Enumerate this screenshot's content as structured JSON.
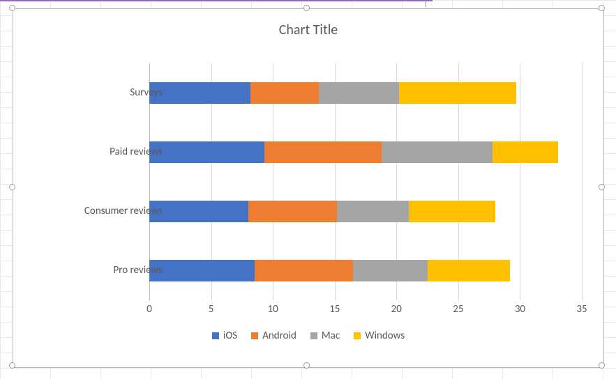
{
  "chart_data": {
    "type": "bar",
    "orientation": "horizontal",
    "stacked": true,
    "title": "Chart Title",
    "xlabel": "",
    "ylabel": "",
    "xlim": [
      0,
      35
    ],
    "xticks": [
      0,
      5,
      10,
      15,
      20,
      25,
      30,
      35
    ],
    "categories": [
      "Pro reviews",
      "Consumer reviews",
      "Paid reviews",
      "Surveys"
    ],
    "series": [
      {
        "name": "iOS",
        "color": "#4472C4",
        "values": [
          8.5,
          8.0,
          9.3,
          8.2
        ]
      },
      {
        "name": "Android",
        "color": "#ED7D31",
        "values": [
          8.0,
          7.2,
          9.5,
          5.5
        ]
      },
      {
        "name": "Mac",
        "color": "#A5A5A5",
        "values": [
          6.0,
          5.8,
          9.0,
          6.5
        ]
      },
      {
        "name": "Windows",
        "color": "#FFC000",
        "values": [
          6.7,
          7.0,
          5.3,
          9.5
        ]
      }
    ]
  }
}
